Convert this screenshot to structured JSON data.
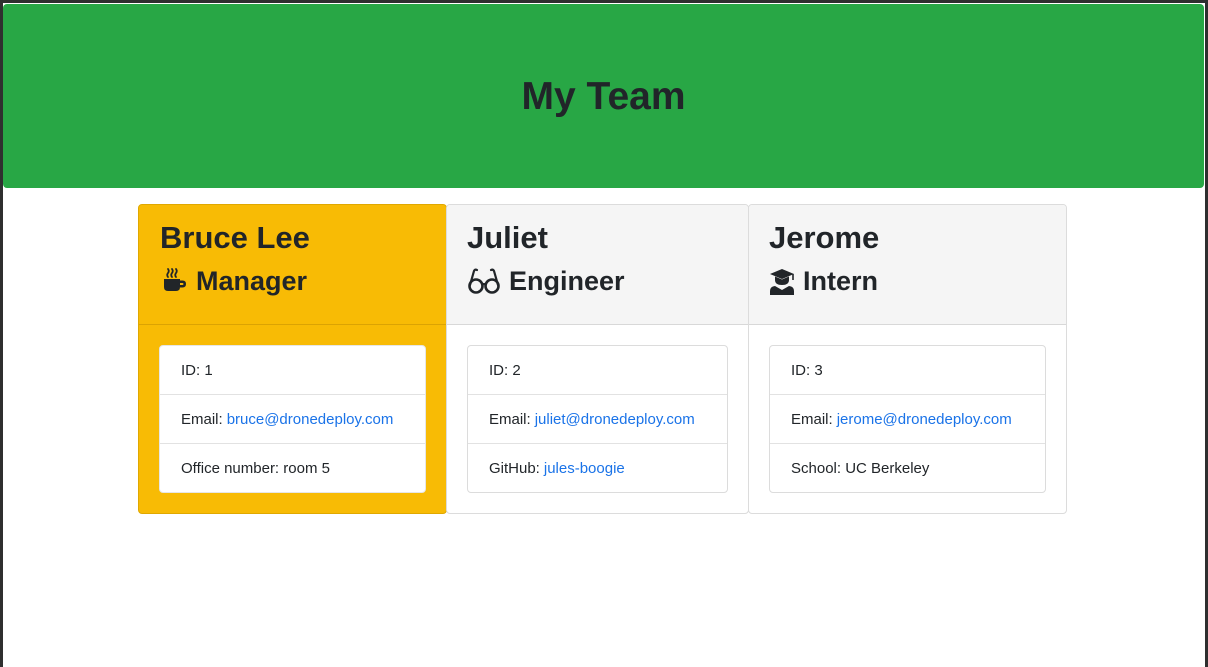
{
  "header": {
    "title": "My Team"
  },
  "team": [
    {
      "name": "Bruce Lee",
      "role": "Manager",
      "role_icon": "coffee-icon",
      "id_label": "ID: 1",
      "email_label": "Email:",
      "email": "bruce@dronedeploy.com",
      "extra_label": "Office number: room 5",
      "accent": "#f8bb05"
    },
    {
      "name": "Juliet",
      "role": "Engineer",
      "role_icon": "glasses-icon",
      "id_label": "ID: 2",
      "email_label": "Email:",
      "email": "juliet@dronedeploy.com",
      "extra_label": "GitHub:",
      "extra_link": "jules-boogie"
    },
    {
      "name": "Jerome",
      "role": "Intern",
      "role_icon": "graduate-icon",
      "id_label": "ID: 3",
      "email_label": "Email:",
      "email": "jerome@dronedeploy.com",
      "extra_label": "School: UC Berkeley"
    }
  ],
  "colors": {
    "header_bg": "#28a745",
    "manager_bg": "#f8bb05",
    "link": "#1a73e8"
  }
}
